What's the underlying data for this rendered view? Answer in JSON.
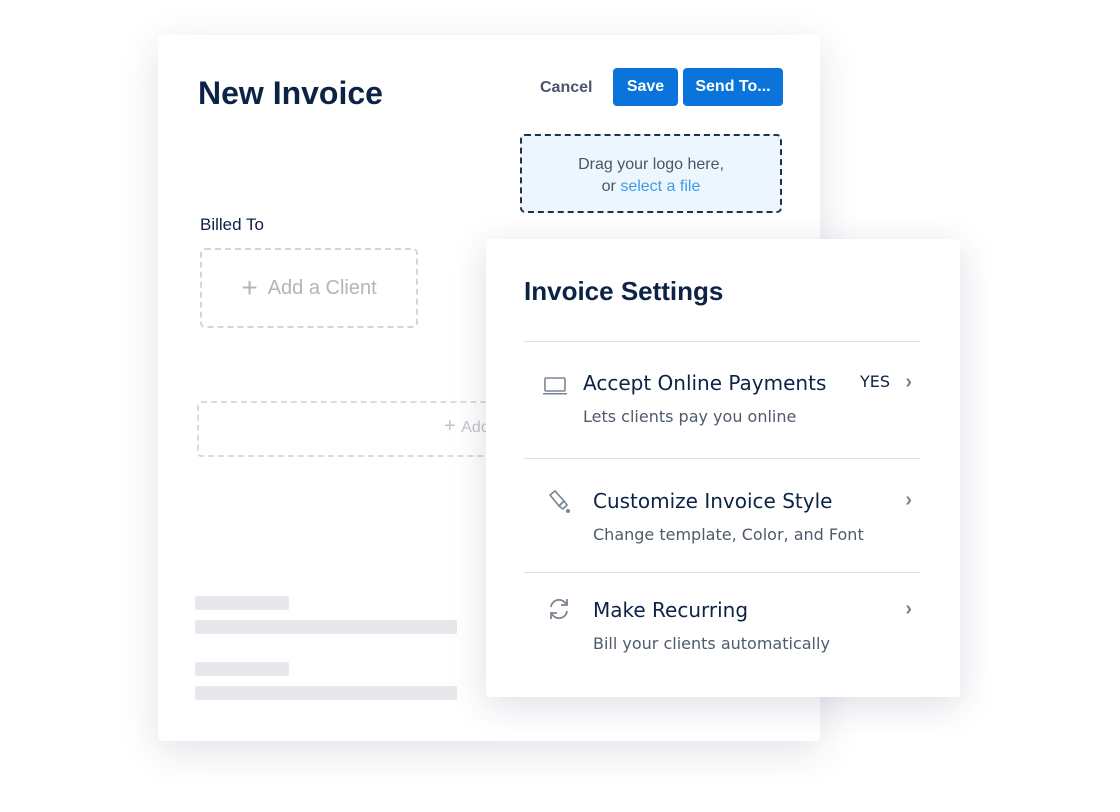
{
  "invoice": {
    "title": "New Invoice",
    "cancel": "Cancel",
    "save": "Save",
    "send": "Send To...",
    "logo_line1": "Drag your logo here,",
    "logo_or": "or ",
    "logo_link": "select a file",
    "billed_to": "Billed To",
    "add_client": "Add a Client",
    "add_line": "Add"
  },
  "settings": {
    "title": "Invoice Settings",
    "items": [
      {
        "title": "Accept Online Payments",
        "subtitle": "Lets clients pay you online",
        "value": "YES",
        "icon": "laptop-icon"
      },
      {
        "title": "Customize Invoice Style",
        "subtitle": "Change template, Color, and Font",
        "icon": "paintbrush-icon"
      },
      {
        "title": "Make Recurring",
        "subtitle": "Bill your clients automatically",
        "icon": "refresh-icon"
      }
    ]
  },
  "colors": {
    "primary": "#0a74da",
    "navy": "#0d2345",
    "link": "#3d9be9"
  }
}
